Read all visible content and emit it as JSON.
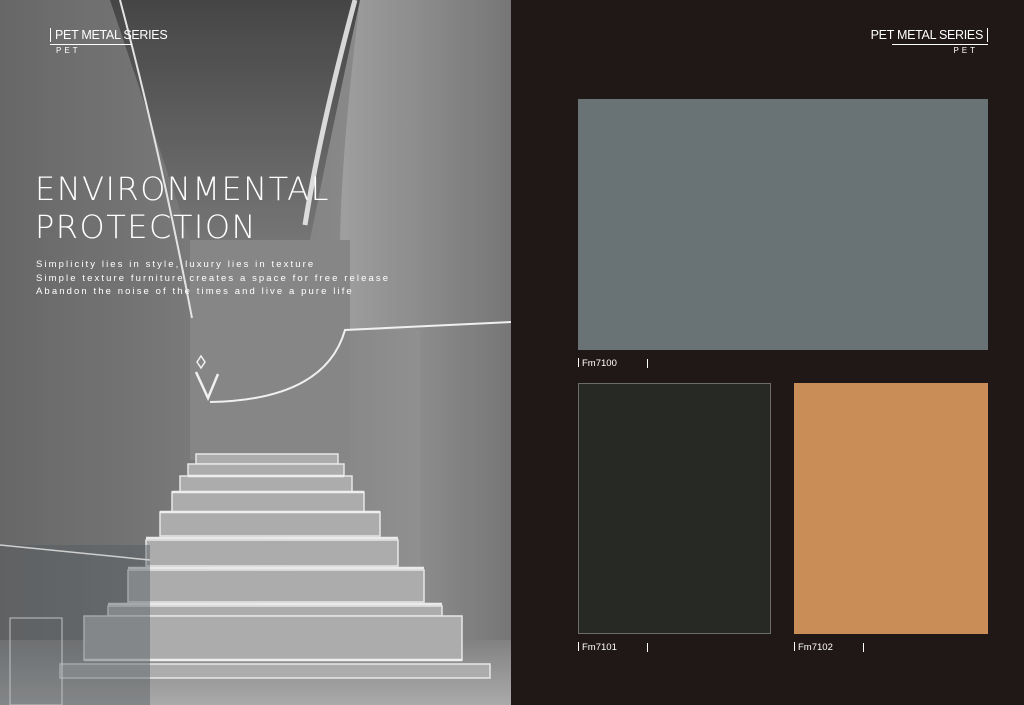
{
  "brand": {
    "name": "PET METAL SERIES",
    "sub": "PET"
  },
  "left_page": {
    "headline": [
      "ENVIRONMENTAL",
      "PROTECTION"
    ],
    "tagline": [
      "Simplicity lies in style, luxury lies in texture",
      "Simple texture furniture creates a space for free release",
      "Abandon the noise of the times and live a pure life"
    ]
  },
  "swatches": [
    {
      "code": "Fm7100",
      "color": "#697375"
    },
    {
      "code": "Fm7101",
      "color": "#272925"
    },
    {
      "code": "Fm7102",
      "color": "#c98d58"
    }
  ]
}
